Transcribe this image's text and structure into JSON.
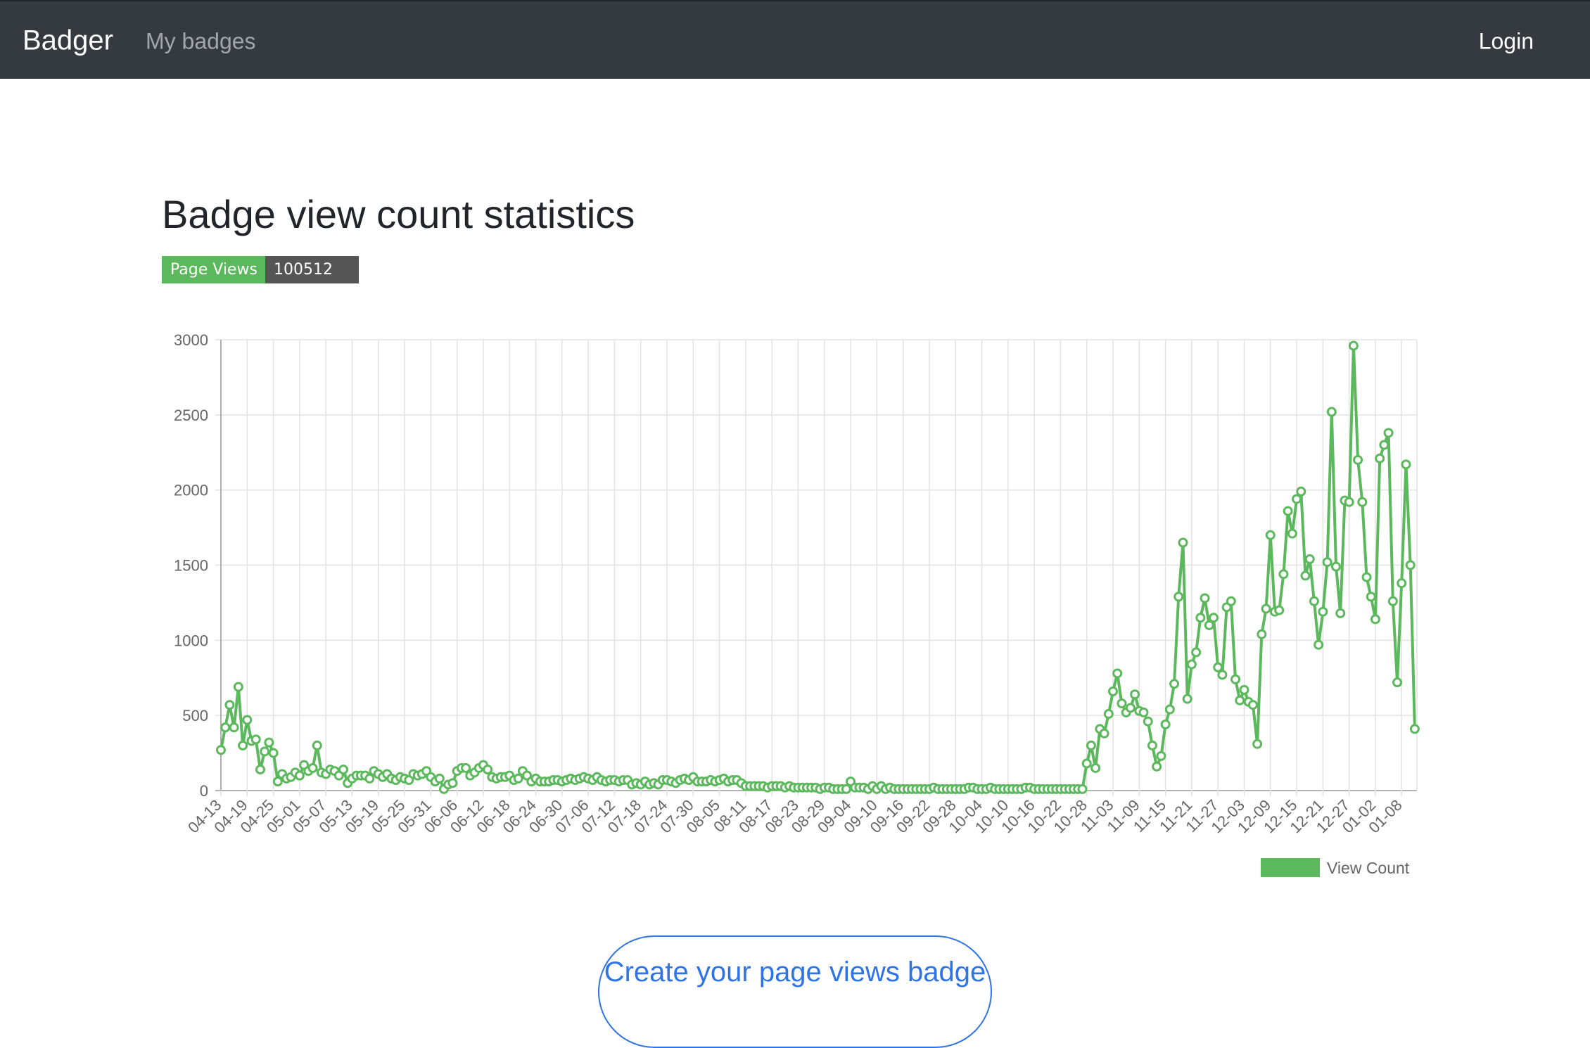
{
  "navbar": {
    "brand": "Badger",
    "links": [
      "My badges"
    ],
    "login": "Login"
  },
  "page": {
    "title": "Badge view count statistics"
  },
  "badge": {
    "label": "Page Views",
    "value": "100512",
    "label_color": "#5cb85c",
    "value_color": "#555555"
  },
  "cta": {
    "label": "Create your page views badge"
  },
  "colors": {
    "navbar_bg": "#343a40",
    "series": "#5cb85c",
    "cta": "#2f74e6"
  },
  "chart_data": {
    "type": "line",
    "title": "",
    "xlabel": "",
    "ylabel": "",
    "ylim": [
      0,
      3000
    ],
    "yticks": [
      0,
      500,
      1000,
      1500,
      2000,
      2500,
      3000
    ],
    "grid": true,
    "legend_position": "bottom-right",
    "x_tick_labels": [
      "04-13",
      "04-19",
      "04-25",
      "05-01",
      "05-07",
      "05-13",
      "05-19",
      "05-25",
      "05-31",
      "06-06",
      "06-12",
      "06-18",
      "06-24",
      "06-30",
      "07-06",
      "07-12",
      "07-18",
      "07-24",
      "07-30",
      "08-05",
      "08-11",
      "08-17",
      "08-23",
      "08-29",
      "09-04",
      "09-10",
      "09-16",
      "09-22",
      "09-28",
      "10-04",
      "10-10",
      "10-16",
      "10-22",
      "10-28",
      "11-03",
      "11-09",
      "11-15",
      "11-21",
      "11-27",
      "12-03",
      "12-09",
      "12-15",
      "12-21",
      "12-27",
      "01-02",
      "01-08"
    ],
    "series": [
      {
        "name": "View Count",
        "color": "#5cb85c",
        "points": [
          [
            "04-13",
            270
          ],
          [
            "04-14",
            420
          ],
          [
            "04-15",
            570
          ],
          [
            "04-16",
            420
          ],
          [
            "04-17",
            690
          ],
          [
            "04-18",
            300
          ],
          [
            "04-19",
            470
          ],
          [
            "04-20",
            330
          ],
          [
            "04-21",
            340
          ],
          [
            "04-22",
            140
          ],
          [
            "04-23",
            260
          ],
          [
            "04-24",
            320
          ],
          [
            "04-25",
            250
          ],
          [
            "04-26",
            60
          ],
          [
            "04-27",
            110
          ],
          [
            "04-28",
            80
          ],
          [
            "04-29",
            90
          ],
          [
            "04-30",
            120
          ],
          [
            "05-01",
            100
          ],
          [
            "05-02",
            170
          ],
          [
            "05-03",
            130
          ],
          [
            "05-04",
            150
          ],
          [
            "05-05",
            300
          ],
          [
            "05-06",
            120
          ],
          [
            "05-07",
            110
          ],
          [
            "05-08",
            140
          ],
          [
            "05-09",
            130
          ],
          [
            "05-10",
            100
          ],
          [
            "05-11",
            140
          ],
          [
            "05-12",
            50
          ],
          [
            "05-13",
            80
          ],
          [
            "05-14",
            100
          ],
          [
            "05-15",
            100
          ],
          [
            "05-16",
            100
          ],
          [
            "05-17",
            80
          ],
          [
            "05-18",
            130
          ],
          [
            "05-19",
            110
          ],
          [
            "05-20",
            90
          ],
          [
            "05-21",
            110
          ],
          [
            "05-22",
            80
          ],
          [
            "05-23",
            70
          ],
          [
            "05-24",
            90
          ],
          [
            "05-25",
            80
          ],
          [
            "05-26",
            70
          ],
          [
            "05-27",
            110
          ],
          [
            "05-28",
            100
          ],
          [
            "05-29",
            110
          ],
          [
            "05-30",
            130
          ],
          [
            "05-31",
            90
          ],
          [
            "06-01",
            60
          ],
          [
            "06-02",
            80
          ],
          [
            "06-03",
            10
          ],
          [
            "06-04",
            40
          ],
          [
            "06-05",
            50
          ],
          [
            "06-06",
            130
          ],
          [
            "06-07",
            150
          ],
          [
            "06-08",
            150
          ],
          [
            "06-09",
            100
          ],
          [
            "06-10",
            120
          ],
          [
            "06-11",
            150
          ],
          [
            "06-12",
            170
          ],
          [
            "06-13",
            140
          ],
          [
            "06-14",
            90
          ],
          [
            "06-15",
            80
          ],
          [
            "06-16",
            90
          ],
          [
            "06-17",
            90
          ],
          [
            "06-18",
            100
          ],
          [
            "06-19",
            70
          ],
          [
            "06-20",
            80
          ],
          [
            "06-21",
            130
          ],
          [
            "06-22",
            100
          ],
          [
            "06-23",
            60
          ],
          [
            "06-24",
            80
          ],
          [
            "06-25",
            60
          ],
          [
            "06-26",
            60
          ],
          [
            "06-27",
            60
          ],
          [
            "06-28",
            70
          ],
          [
            "06-29",
            70
          ],
          [
            "06-30",
            60
          ],
          [
            "07-01",
            70
          ],
          [
            "07-02",
            80
          ],
          [
            "07-03",
            70
          ],
          [
            "07-04",
            80
          ],
          [
            "07-05",
            90
          ],
          [
            "07-06",
            80
          ],
          [
            "07-07",
            70
          ],
          [
            "07-08",
            90
          ],
          [
            "07-09",
            70
          ],
          [
            "07-10",
            60
          ],
          [
            "07-11",
            70
          ],
          [
            "07-12",
            70
          ],
          [
            "07-13",
            60
          ],
          [
            "07-14",
            70
          ],
          [
            "07-15",
            70
          ],
          [
            "07-16",
            40
          ],
          [
            "07-17",
            50
          ],
          [
            "07-18",
            40
          ],
          [
            "07-19",
            60
          ],
          [
            "07-20",
            40
          ],
          [
            "07-21",
            50
          ],
          [
            "07-22",
            40
          ],
          [
            "07-23",
            70
          ],
          [
            "07-24",
            70
          ],
          [
            "07-25",
            60
          ],
          [
            "07-26",
            50
          ],
          [
            "07-27",
            70
          ],
          [
            "07-28",
            80
          ],
          [
            "07-29",
            70
          ],
          [
            "07-30",
            90
          ],
          [
            "07-31",
            60
          ],
          [
            "08-01",
            60
          ],
          [
            "08-02",
            60
          ],
          [
            "08-03",
            70
          ],
          [
            "08-04",
            60
          ],
          [
            "08-05",
            70
          ],
          [
            "08-06",
            80
          ],
          [
            "08-07",
            60
          ],
          [
            "08-08",
            70
          ],
          [
            "08-09",
            70
          ],
          [
            "08-10",
            50
          ],
          [
            "08-11",
            30
          ],
          [
            "08-12",
            30
          ],
          [
            "08-13",
            30
          ],
          [
            "08-14",
            30
          ],
          [
            "08-15",
            30
          ],
          [
            "08-16",
            20
          ],
          [
            "08-17",
            30
          ],
          [
            "08-18",
            30
          ],
          [
            "08-19",
            30
          ],
          [
            "08-20",
            20
          ],
          [
            "08-21",
            30
          ],
          [
            "08-22",
            20
          ],
          [
            "08-23",
            20
          ],
          [
            "08-24",
            20
          ],
          [
            "08-25",
            20
          ],
          [
            "08-26",
            20
          ],
          [
            "08-27",
            20
          ],
          [
            "08-28",
            10
          ],
          [
            "08-29",
            20
          ],
          [
            "08-30",
            20
          ],
          [
            "08-31",
            10
          ],
          [
            "09-01",
            10
          ],
          [
            "09-02",
            10
          ],
          [
            "09-03",
            10
          ],
          [
            "09-04",
            60
          ],
          [
            "09-05",
            20
          ],
          [
            "09-06",
            20
          ],
          [
            "09-07",
            20
          ],
          [
            "09-08",
            10
          ],
          [
            "09-09",
            30
          ],
          [
            "09-10",
            10
          ],
          [
            "09-11",
            30
          ],
          [
            "09-12",
            10
          ],
          [
            "09-13",
            20
          ],
          [
            "09-14",
            10
          ],
          [
            "09-15",
            10
          ],
          [
            "09-16",
            10
          ],
          [
            "09-17",
            10
          ],
          [
            "09-18",
            10
          ],
          [
            "09-19",
            10
          ],
          [
            "09-20",
            10
          ],
          [
            "09-21",
            10
          ],
          [
            "09-22",
            10
          ],
          [
            "09-23",
            20
          ],
          [
            "09-24",
            10
          ],
          [
            "09-25",
            10
          ],
          [
            "09-26",
            10
          ],
          [
            "09-27",
            10
          ],
          [
            "09-28",
            10
          ],
          [
            "09-29",
            10
          ],
          [
            "09-30",
            10
          ],
          [
            "10-01",
            20
          ],
          [
            "10-02",
            20
          ],
          [
            "10-03",
            10
          ],
          [
            "10-04",
            10
          ],
          [
            "10-05",
            10
          ],
          [
            "10-06",
            20
          ],
          [
            "10-07",
            10
          ],
          [
            "10-08",
            10
          ],
          [
            "10-09",
            10
          ],
          [
            "10-10",
            10
          ],
          [
            "10-11",
            10
          ],
          [
            "10-12",
            10
          ],
          [
            "10-13",
            10
          ],
          [
            "10-14",
            20
          ],
          [
            "10-15",
            20
          ],
          [
            "10-16",
            10
          ],
          [
            "10-17",
            10
          ],
          [
            "10-18",
            10
          ],
          [
            "10-19",
            10
          ],
          [
            "10-20",
            10
          ],
          [
            "10-21",
            10
          ],
          [
            "10-22",
            10
          ],
          [
            "10-23",
            10
          ],
          [
            "10-24",
            10
          ],
          [
            "10-25",
            10
          ],
          [
            "10-26",
            10
          ],
          [
            "10-27",
            10
          ],
          [
            "10-28",
            180
          ],
          [
            "10-29",
            300
          ],
          [
            "10-30",
            150
          ],
          [
            "10-31",
            410
          ],
          [
            "11-01",
            380
          ],
          [
            "11-02",
            510
          ],
          [
            "11-03",
            660
          ],
          [
            "11-04",
            780
          ],
          [
            "11-05",
            580
          ],
          [
            "11-06",
            520
          ],
          [
            "11-07",
            550
          ],
          [
            "11-08",
            640
          ],
          [
            "11-09",
            530
          ],
          [
            "11-10",
            520
          ],
          [
            "11-11",
            460
          ],
          [
            "11-12",
            300
          ],
          [
            "11-13",
            160
          ],
          [
            "11-14",
            230
          ],
          [
            "11-15",
            440
          ],
          [
            "11-16",
            540
          ],
          [
            "11-17",
            710
          ],
          [
            "11-18",
            1290
          ],
          [
            "11-19",
            1650
          ],
          [
            "11-20",
            610
          ],
          [
            "11-21",
            840
          ],
          [
            "11-22",
            920
          ],
          [
            "11-23",
            1150
          ],
          [
            "11-24",
            1280
          ],
          [
            "11-25",
            1100
          ],
          [
            "11-26",
            1150
          ],
          [
            "11-27",
            820
          ],
          [
            "11-28",
            770
          ],
          [
            "11-29",
            1220
          ],
          [
            "11-30",
            1260
          ],
          [
            "12-01",
            740
          ],
          [
            "12-02",
            600
          ],
          [
            "12-03",
            670
          ],
          [
            "12-04",
            590
          ],
          [
            "12-05",
            570
          ],
          [
            "12-06",
            310
          ],
          [
            "12-07",
            1040
          ],
          [
            "12-08",
            1210
          ],
          [
            "12-09",
            1700
          ],
          [
            "12-10",
            1190
          ],
          [
            "12-11",
            1200
          ],
          [
            "12-12",
            1440
          ],
          [
            "12-13",
            1860
          ],
          [
            "12-14",
            1710
          ],
          [
            "12-15",
            1940
          ],
          [
            "12-16",
            1990
          ],
          [
            "12-17",
            1430
          ],
          [
            "12-18",
            1540
          ],
          [
            "12-19",
            1260
          ],
          [
            "12-20",
            970
          ],
          [
            "12-21",
            1190
          ],
          [
            "12-22",
            1520
          ],
          [
            "12-23",
            2520
          ],
          [
            "12-24",
            1490
          ],
          [
            "12-25",
            1180
          ],
          [
            "12-26",
            1930
          ],
          [
            "12-27",
            1920
          ],
          [
            "12-28",
            2960
          ],
          [
            "12-29",
            2200
          ],
          [
            "12-30",
            1920
          ],
          [
            "12-31",
            1420
          ],
          [
            "01-01",
            1290
          ],
          [
            "01-02",
            1140
          ],
          [
            "01-03",
            2210
          ],
          [
            "01-04",
            2300
          ],
          [
            "01-05",
            2380
          ],
          [
            "01-06",
            1260
          ],
          [
            "01-07",
            720
          ],
          [
            "01-08",
            1380
          ],
          [
            "01-09",
            2170
          ],
          [
            "01-10",
            1500
          ],
          [
            "01-11",
            410
          ]
        ]
      }
    ]
  }
}
